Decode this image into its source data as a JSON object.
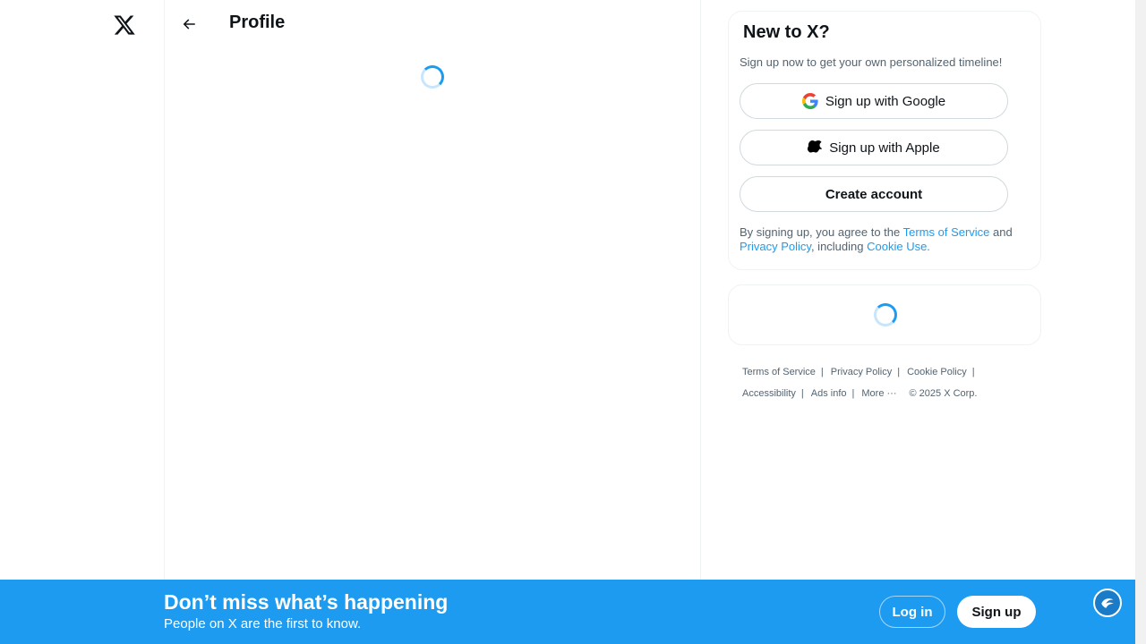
{
  "header": {
    "title": "Profile"
  },
  "signup_card": {
    "title": "New to X?",
    "subtitle": "Sign up now to get your own personalized timeline!",
    "google_label": "Sign up with Google",
    "apple_label": "Sign up with Apple",
    "create_label": "Create account",
    "legal": {
      "prefix": "By signing up, you agree to the ",
      "terms": "Terms of Service",
      "and": " and",
      "privacy": "Privacy Policy",
      "including": ", including ",
      "cookie": "Cookie Use."
    }
  },
  "footer": {
    "links": [
      "Terms of Service",
      "Privacy Policy",
      "Cookie Policy",
      "Accessibility",
      "Ads info",
      "More"
    ],
    "copyright": "© 2025 X Corp."
  },
  "banner": {
    "title": "Don’t miss what’s happening",
    "subtitle": "People on X are the first to know.",
    "login_label": "Log in",
    "signup_label": "Sign up"
  },
  "icons": {
    "logo": "x-logo-icon",
    "back": "arrow-left-icon",
    "google": "google-icon",
    "apple": "apple-icon",
    "more": "ellipsis-icon",
    "fab": "assistant-icon"
  },
  "colors": {
    "accent": "#1d9bf0",
    "text": "#0f1419",
    "muted": "#536471"
  }
}
